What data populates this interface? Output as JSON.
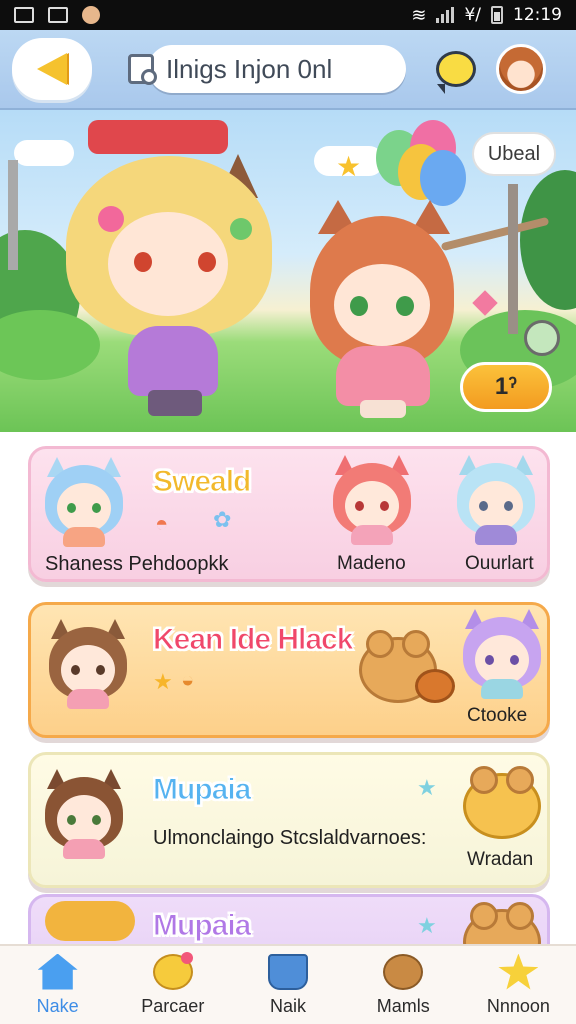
{
  "status_bar": {
    "signal": "¥/",
    "time": "12:19"
  },
  "header": {
    "title": "Ilnigs Injon 0nl"
  },
  "hero": {
    "sticker_button_label": "Ubeal",
    "counter_label": "1ˀ"
  },
  "cards": [
    {
      "title": "Sweald",
      "title_color": "#f2b92c",
      "subtitle": "Shaness Pehdoopkk",
      "labels": [
        "Madeno",
        "Ouurlart"
      ]
    },
    {
      "title": "Kean Ide Hlack",
      "title_color": "#f0486a",
      "labels": [
        "Ctooke"
      ]
    },
    {
      "title": "Mupaia",
      "title_color": "#56b3f0",
      "subtitle": "Ulmonclaingo Stcslaldvarnoes:",
      "labels": [
        "Wradan"
      ]
    },
    {
      "title": "Mupaia",
      "title_color": "#b078e6"
    }
  ],
  "bottom_nav": [
    {
      "label": "Nake",
      "icon": "home-icon",
      "active": true
    },
    {
      "label": "Parcaer",
      "icon": "chat-bubble-icon",
      "active": false
    },
    {
      "label": "Naik",
      "icon": "cup-icon",
      "active": false
    },
    {
      "label": "Mamls",
      "icon": "bear-icon",
      "active": false
    },
    {
      "label": "Nnnoon",
      "icon": "star-icon",
      "active": false
    }
  ],
  "colors": {
    "accent": "#3e8de6",
    "header_bg": "#b5d3f1",
    "counter_button": "#f7a823"
  }
}
